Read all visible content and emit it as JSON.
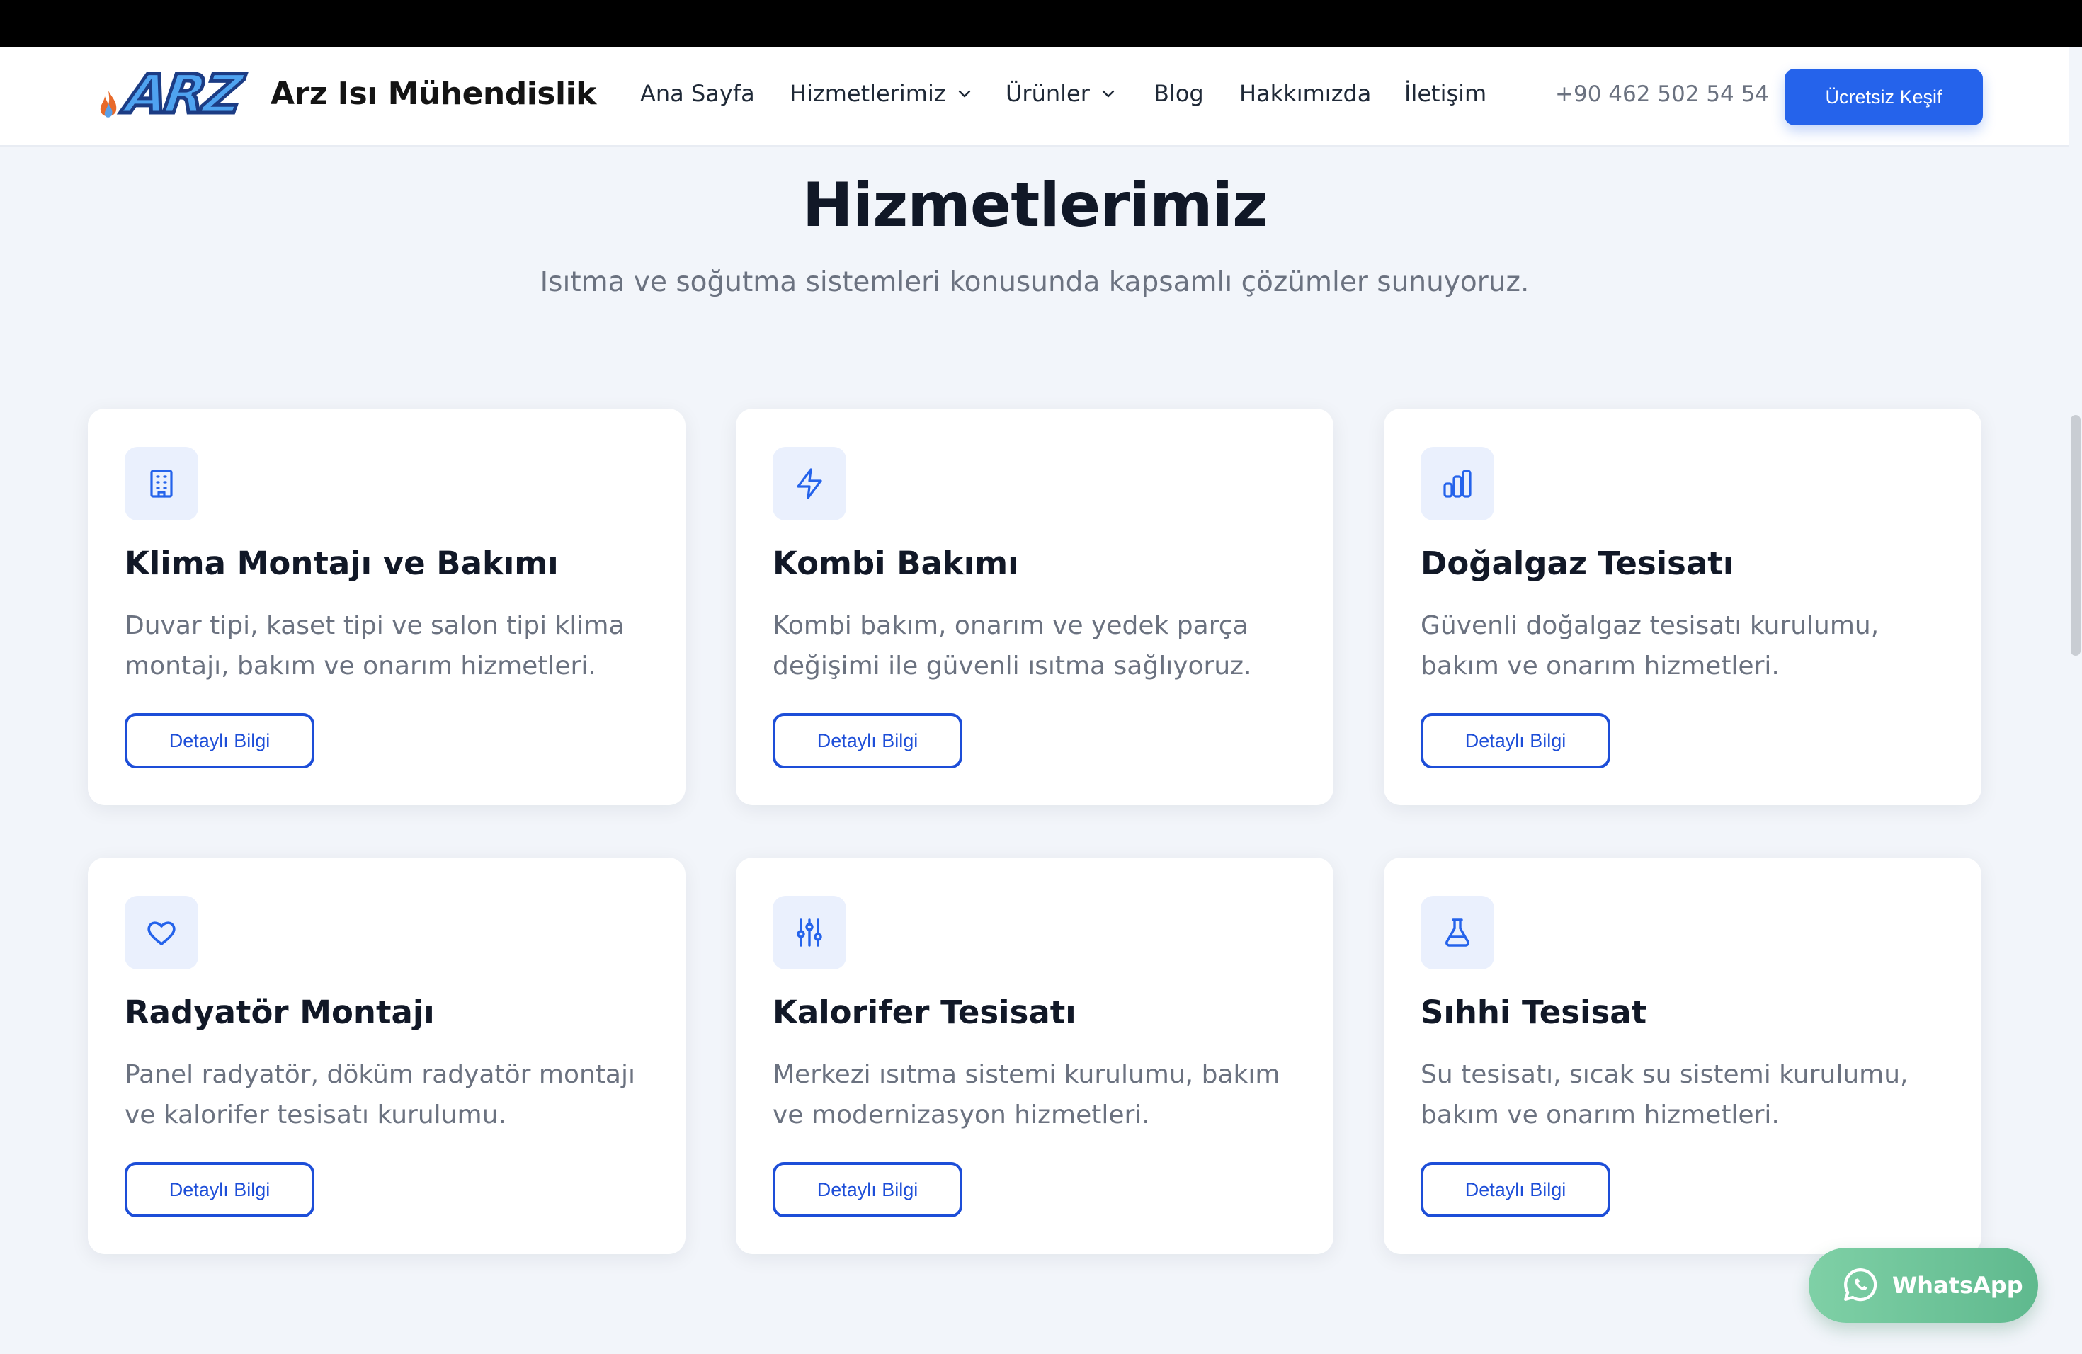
{
  "brand": {
    "logo_text": "ARZ",
    "name": "Arz Isı Mühendislik"
  },
  "nav": {
    "items": [
      {
        "label": "Ana Sayfa",
        "has_dropdown": false
      },
      {
        "label": "Hizmetlerimiz",
        "has_dropdown": true
      },
      {
        "label": "Ürünler",
        "has_dropdown": true
      },
      {
        "label": "Blog",
        "has_dropdown": false
      },
      {
        "label": "Hakkımızda",
        "has_dropdown": false
      },
      {
        "label": "İletişim",
        "has_dropdown": false
      }
    ],
    "phone": "+90 462 502 54 54",
    "cta_label": "Ücretsiz Keşif"
  },
  "section": {
    "title": "Hizmetlerimiz",
    "subtitle": "Isıtma ve soğutma sistemleri konusunda kapsamlı çözümler sunuyoruz."
  },
  "services": [
    {
      "icon": "building-icon",
      "title": "Klima Montajı ve Bakımı",
      "description": "Duvar tipi, kaset tipi ve salon tipi klima montajı, bakım ve onarım hizmetleri.",
      "button": "Detaylı Bilgi"
    },
    {
      "icon": "lightning-icon",
      "title": "Kombi Bakımı",
      "description": "Kombi bakım, onarım ve yedek parça değişimi ile güvenli ısıtma sağlıyoruz.",
      "button": "Detaylı Bilgi"
    },
    {
      "icon": "bar-chart-icon",
      "title": "Doğalgaz Tesisatı",
      "description": "Güvenli doğalgaz tesisatı kurulumu, bakım ve onarım hizmetleri.",
      "button": "Detaylı Bilgi"
    },
    {
      "icon": "heart-icon",
      "title": "Radyatör Montajı",
      "description": "Panel radyatör, döküm radyatör montajı ve kalorifer tesisatı kurulumu.",
      "button": "Detaylı Bilgi"
    },
    {
      "icon": "sliders-icon",
      "title": "Kalorifer Tesisatı",
      "description": "Merkezi ısıtma sistemi kurulumu, bakım ve modernizasyon hizmetleri.",
      "button": "Detaylı Bilgi"
    },
    {
      "icon": "flask-icon",
      "title": "Sıhhi Tesisat",
      "description": "Su tesisatı, sıcak su sistemi kurulumu, bakım ve onarım hizmetleri.",
      "button": "Detaylı Bilgi"
    }
  ],
  "whatsapp": {
    "label": "WhatsApp"
  },
  "colors": {
    "primary": "#2563eb",
    "icon_bg": "#eaf0fd",
    "page_bg": "#f2f5fa",
    "whatsapp": "#6cc49a"
  }
}
